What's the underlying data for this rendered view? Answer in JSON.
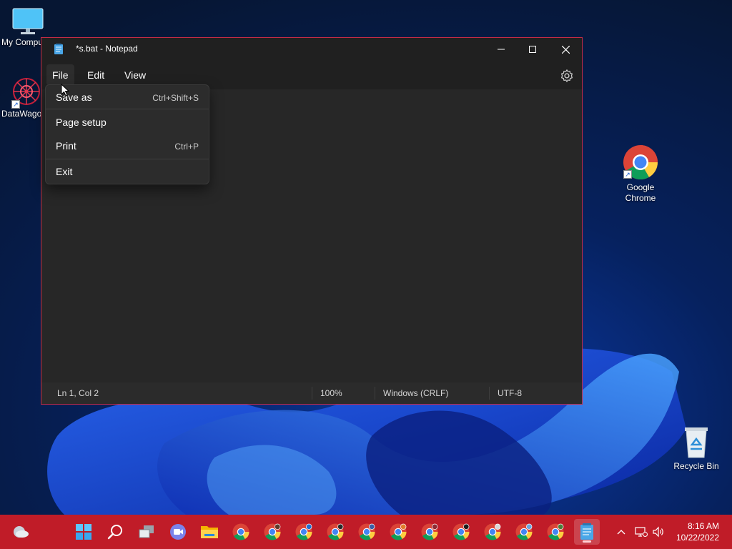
{
  "desktop": {
    "icons": [
      {
        "label": "My Compu"
      },
      {
        "label": "DataWago"
      },
      {
        "label": "Google Chrome"
      },
      {
        "label": "Recycle Bin"
      }
    ]
  },
  "window": {
    "title": "*s.bat - Notepad",
    "menu": [
      "File",
      "Edit",
      "View"
    ],
    "active_menu": "File",
    "file_menu": [
      {
        "label": "Save as",
        "shortcut": "Ctrl+Shift+S"
      },
      {
        "label": "Page setup",
        "shortcut": ""
      },
      {
        "label": "Print",
        "shortcut": "Ctrl+P"
      },
      {
        "label": "Exit",
        "shortcut": ""
      }
    ],
    "status": {
      "position": "Ln 1, Col 2",
      "zoom": "100%",
      "line_ending": "Windows (CRLF)",
      "encoding": "UTF-8"
    }
  },
  "taskbar": {
    "time": "8:16 AM",
    "date": "10/22/2022",
    "apps": [
      "widgets",
      "start",
      "search",
      "task-view",
      "teams-chat",
      "file-explorer",
      "chrome",
      "chrome",
      "chrome",
      "chrome",
      "chrome",
      "chrome",
      "chrome",
      "chrome",
      "chrome",
      "chrome",
      "chrome",
      "notepad"
    ]
  },
  "colors": {
    "taskbar": "#c01c28",
    "window_border": "#c42b46",
    "window_bg": "#272727"
  }
}
